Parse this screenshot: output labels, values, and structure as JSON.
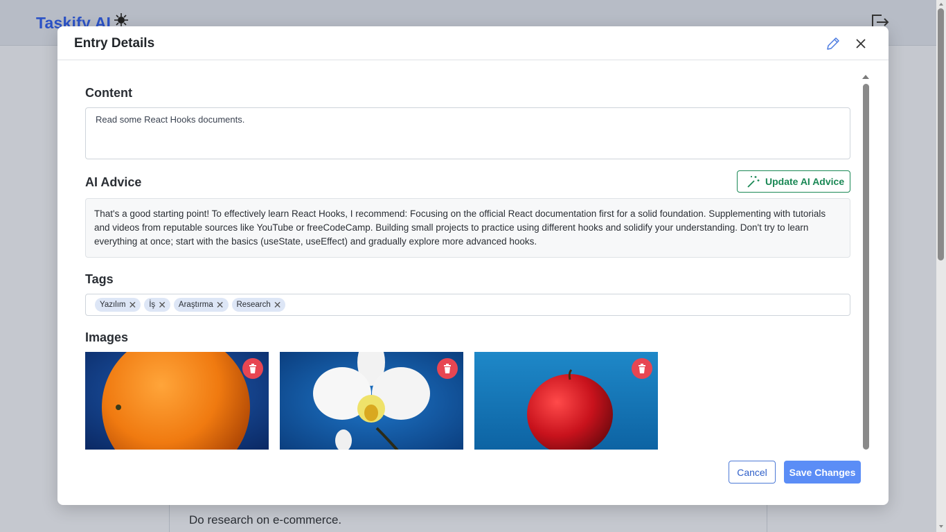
{
  "app": {
    "brand": "Taskify AI",
    "background_entry_text": "Do research on e-commerce."
  },
  "modal": {
    "title": "Entry Details",
    "content_label": "Content",
    "content_value": "Read some React Hooks documents.",
    "ai_advice_label": "AI Advice",
    "update_ai_button": "Update AI Advice",
    "ai_advice_text": "That's a good starting point! To effectively learn React Hooks, I recommend: Focusing on the official React documentation first for a solid foundation. Supplementing with tutorials and videos from reputable sources like YouTube or freeCodeCamp. Building small projects to practice using different hooks and solidify your understanding. Don't try to learn everything at once; start with the basics (useState, useEffect) and gradually explore more advanced hooks.",
    "tags_label": "Tags",
    "tags": [
      "Yazılım",
      "İş",
      "Araştırma",
      "Research"
    ],
    "images_label": "Images",
    "images": [
      {
        "subject": "orange"
      },
      {
        "subject": "white orchid"
      },
      {
        "subject": "red apple"
      }
    ],
    "cancel_button": "Cancel",
    "save_button": "Save Changes"
  },
  "colors": {
    "brand": "#2b52c6",
    "success": "#198754",
    "primary": "#5b8df6",
    "danger": "#e74652"
  }
}
